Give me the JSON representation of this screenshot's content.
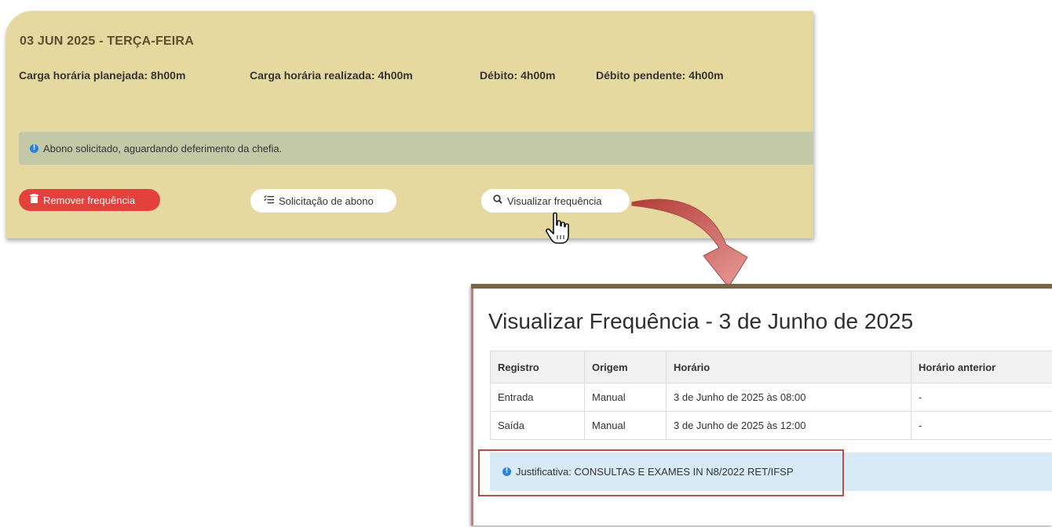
{
  "card": {
    "title": "03 JUN 2025 - TERÇA-FEIRA",
    "stats": {
      "planejada": "Carga horária planejada: 8h00m",
      "realizada": "Carga horária realizada: 4h00m",
      "debito": "Débito: 4h00m",
      "pendente": "Débito pendente: 4h00m"
    },
    "notice": "Abono solicitado, aguardando deferimento da chefia.",
    "buttons": {
      "remover": "Remover frequência",
      "abono": "Solicitação de abono",
      "visualizar": "Visualizar frequência"
    }
  },
  "modal": {
    "title": "Visualizar Frequência - 3 de Junho de 2025",
    "table": {
      "headers": [
        "Registro",
        "Origem",
        "Horário",
        "Horário anterior"
      ],
      "rows": [
        [
          "Entrada",
          "Manual",
          "3 de Junho de 2025 às 08:00",
          "-"
        ],
        [
          "Saída",
          "Manual",
          "3 de Junho de 2025 às 12:00",
          "-"
        ]
      ]
    },
    "justificativa": "Justificativa: CONSULTAS E EXAMES IN N8/2022 RET/IFSP"
  },
  "colors": {
    "card_bg": "#e6d9a0",
    "notice_bg": "#c3c8a6",
    "danger": "#e2423b",
    "info": "#2e7fd6",
    "arrow": "#c0504d",
    "highlight_border": "#b5534a"
  },
  "icons": {
    "remover": "trash-icon",
    "abono": "checklist-icon",
    "visualizar": "search-icon",
    "info": "info-icon",
    "cursor": "hand-pointer-icon"
  }
}
